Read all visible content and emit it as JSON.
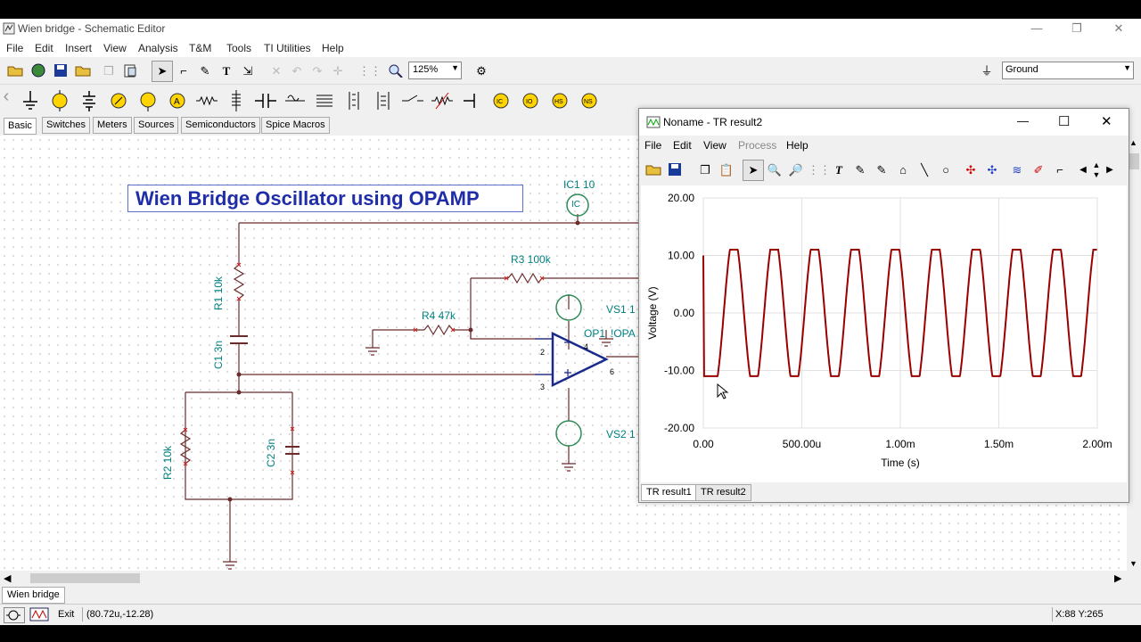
{
  "window": {
    "title": "Wien bridge - Schematic Editor",
    "controls": [
      "—",
      "❐",
      "✕"
    ]
  },
  "menu": [
    "File",
    "Edit",
    "Insert",
    "View",
    "Analysis",
    "T&M",
    "Tools",
    "TI Utilities",
    "Help"
  ],
  "toolbar": {
    "zoom": "125%",
    "ground_select": "Ground"
  },
  "component_tabs": [
    "Basic",
    "Switches",
    "Meters",
    "Sources",
    "Semiconductors",
    "Spice Macros"
  ],
  "schematic": {
    "title": "Wien Bridge Oscillator using OPAMP",
    "labels": {
      "ic1": "IC1 10",
      "ic": "IC",
      "r1": "R1 10k",
      "c1": "C1 3n",
      "r2": "R2 10k",
      "c2": "C2 3n",
      "r3": "R3 100k",
      "r4": "R4 47k",
      "vs1": "VS1 1",
      "vs2": "VS2 1",
      "op1": "OP1",
      "opa": "!OPA",
      "pin2": "2",
      "pin3": "3",
      "pin4": "4",
      "pin6": "6"
    }
  },
  "sheet_tab": "Wien bridge",
  "status": {
    "exit": "Exit",
    "coords": "(80.72u,-12.28)",
    "xy": "X:88  Y:265"
  },
  "result_window": {
    "title": "Noname - TR result2",
    "controls": [
      "—",
      "☐",
      "✕"
    ],
    "menu": [
      "File",
      "Edit",
      "View",
      "Process",
      "Help"
    ],
    "tabs": [
      "TR result1",
      "TR result2"
    ]
  },
  "colors": {
    "waveform": "#990000",
    "schematic_text": "#008080",
    "opamp": "#1a2a8c",
    "wire": "#6b2b2b",
    "title_box": "#1f2ea8"
  },
  "chart_data": {
    "type": "line",
    "xlabel": "Time (s)",
    "ylabel": "Voltage (V)",
    "xlim": [
      0,
      0.002
    ],
    "ylim": [
      -20,
      20
    ],
    "x_ticks": [
      "0.00",
      "500.00u",
      "1.00m",
      "1.50m",
      "2.00m"
    ],
    "y_ticks": [
      "20.00",
      "10.00",
      "0.00",
      "-10.00",
      "-20.00"
    ],
    "grid": true,
    "series": [
      {
        "clip_high": 11,
        "clip_low": -11,
        "startup_value": 10,
        "startup_low_until": 7e-05,
        "period": 0.000205,
        "first_peak": 0.000155,
        "x_end": 0.002
      }
    ]
  }
}
